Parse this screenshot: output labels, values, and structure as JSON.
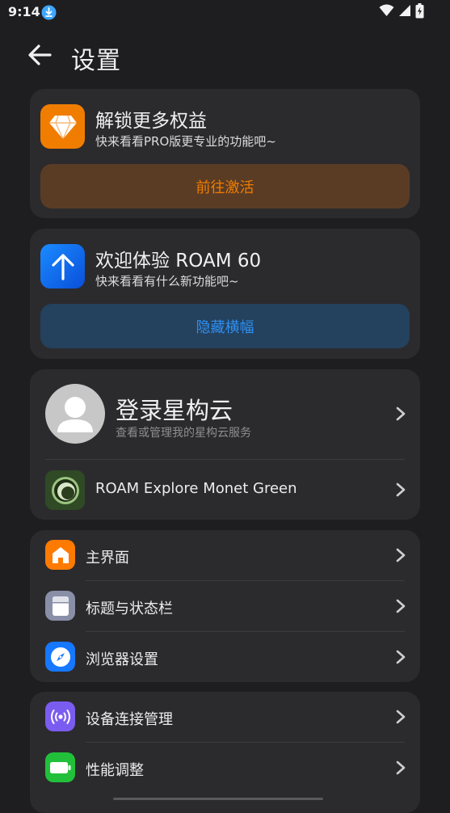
{
  "status_bar": {
    "time": "9:14"
  },
  "header": {
    "title": "设置"
  },
  "pro_card": {
    "title": "解锁更多权益",
    "subtitle": "快来看看PRO版更专业的功能吧~",
    "button_label": "前往激活",
    "icon": "diamond-icon",
    "accent": "#f07d00"
  },
  "welcome_card": {
    "title": "欢迎体验 ROAM 60",
    "subtitle": "快来看看有什么新功能吧~",
    "button_label": "隐藏横幅",
    "icon": "arrow-up-icon",
    "accent": "#2f8ff0"
  },
  "account_card": {
    "login_title": "登录星构云",
    "login_subtitle": "查看或管理我的星构云服务",
    "theme_label": "ROAM Explore Monet Green"
  },
  "settings_group_1": [
    {
      "label": "主界面",
      "icon": "home-icon",
      "color": "#ff7a00"
    },
    {
      "label": "标题与状态栏",
      "icon": "statusbar-icon",
      "color": "#8a8fa8"
    },
    {
      "label": "浏览器设置",
      "icon": "compass-icon",
      "color": "#1677ff"
    }
  ],
  "settings_group_2": [
    {
      "label": "设备连接管理",
      "icon": "broadcast-icon",
      "color": "#7b5cf0"
    },
    {
      "label": "性能调整",
      "icon": "battery-icon",
      "color": "#22c03a"
    }
  ]
}
